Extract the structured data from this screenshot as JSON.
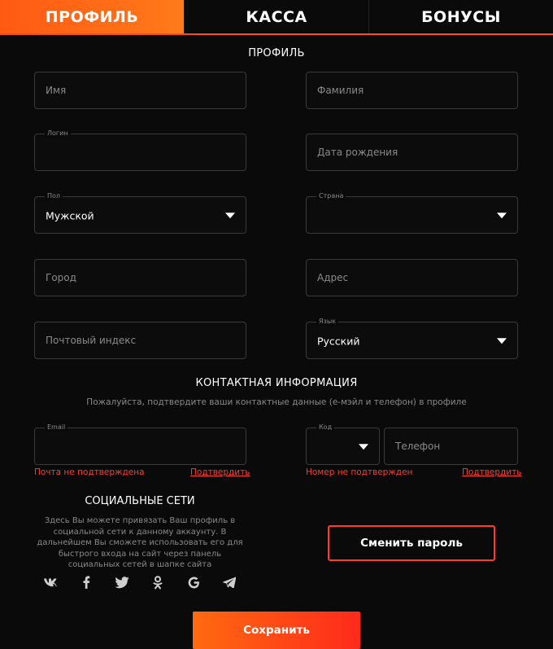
{
  "tabs": [
    {
      "label": "ПРОФИЛЬ",
      "active": true
    },
    {
      "label": "КАССА",
      "active": false
    },
    {
      "label": "БОНУСЫ",
      "active": false
    }
  ],
  "profile": {
    "title": "ПРОФИЛЬ",
    "first_name": {
      "placeholder": "Имя"
    },
    "last_name": {
      "placeholder": "Фамилия"
    },
    "login": {
      "label": "Логин",
      "value": ""
    },
    "birth_date": {
      "placeholder": "Дата рождения"
    },
    "gender": {
      "label": "Пол",
      "value": "Мужской"
    },
    "country": {
      "label": "Страна",
      "value": ""
    },
    "city": {
      "placeholder": "Город"
    },
    "address": {
      "placeholder": "Адрес"
    },
    "postal_code": {
      "placeholder": "Почтовый индекс"
    },
    "language": {
      "label": "Язык",
      "value": "Русский"
    }
  },
  "contact": {
    "title": "КОНТАКТНАЯ ИНФОРМАЦИЯ",
    "subtitle": "Пожалуйста, подтвердите ваши контактные данные (е-мэйл и телефон) в профиле",
    "email": {
      "label": "Email",
      "value": ""
    },
    "email_error": "Почта не подтверждена",
    "email_confirm": "Подтвердить",
    "code": {
      "label": "Код",
      "value": ""
    },
    "phone": {
      "placeholder": "Телефон"
    },
    "phone_error": "Номер не подтвержден",
    "phone_confirm": "Подтвердить"
  },
  "social": {
    "title": "СОЦИАЛЬНЫЕ СЕТИ",
    "text": "Здесь Вы можете привязать Ваш профиль в социальной сети к данному аккаунту. В дальнейшем Вы сможете использовать его для быстрого входа на сайт через панель социальных сетей в шапке сайта",
    "icons": [
      "vk-icon",
      "facebook-icon",
      "twitter-icon",
      "odnoklassniki-icon",
      "google-icon",
      "telegram-icon"
    ]
  },
  "buttons": {
    "change_password": "Сменить пароль",
    "save": "Сохранить"
  },
  "colors": {
    "accent_orange": "#ff6a10",
    "accent_red": "#ff3b30",
    "background": "#0a0a0a",
    "field_border": "#3a3a3a"
  }
}
